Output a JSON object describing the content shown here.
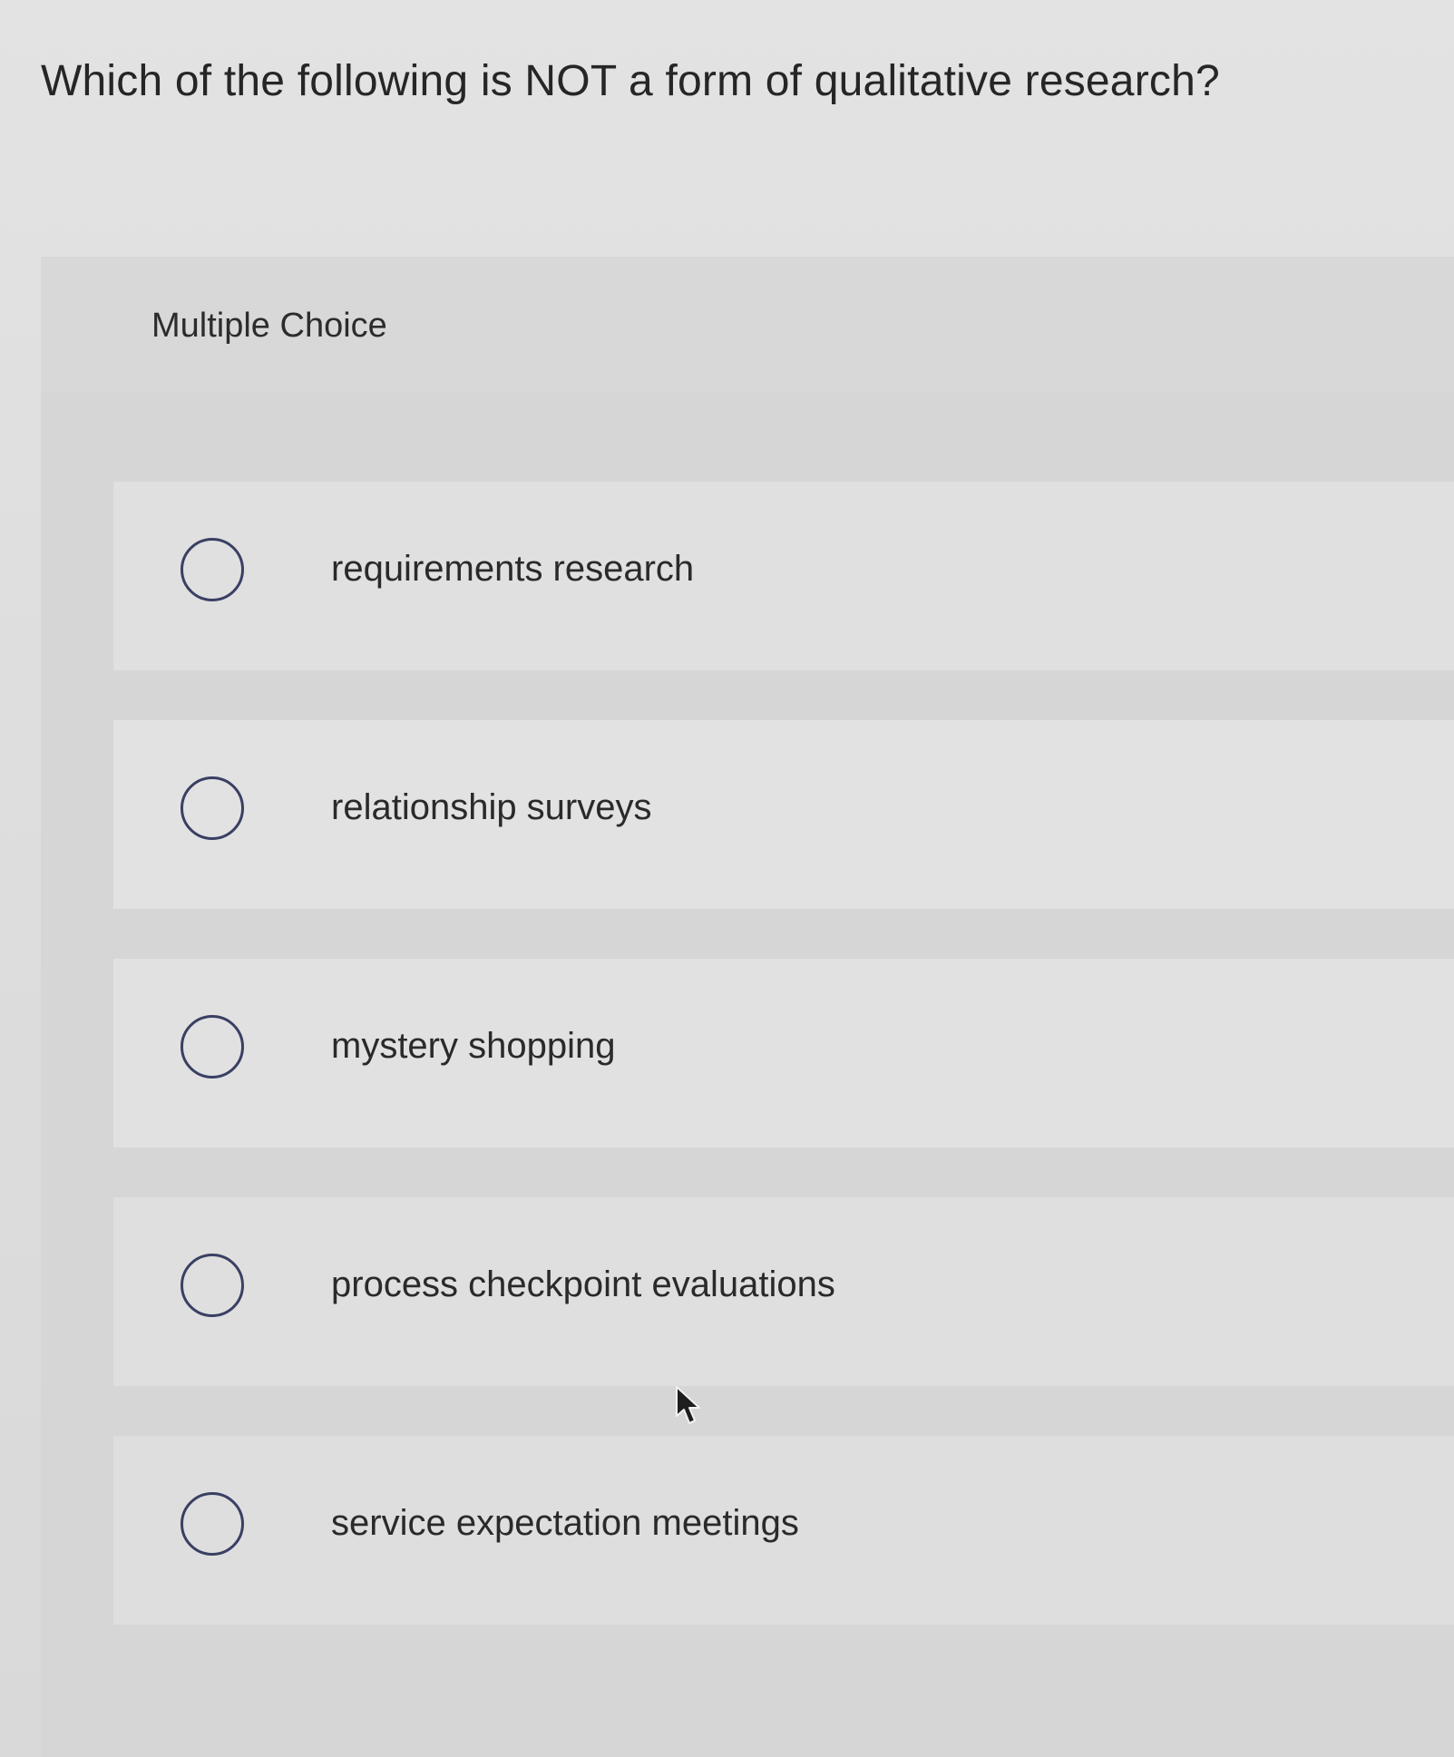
{
  "question": {
    "text": "Which of the following is NOT a form of qualitative research?"
  },
  "card": {
    "header_label": "Multiple Choice"
  },
  "options": [
    {
      "label": "requirements research",
      "selected": false
    },
    {
      "label": "relationship surveys",
      "selected": false
    },
    {
      "label": "mystery shopping",
      "selected": false
    },
    {
      "label": "process checkpoint evaluations",
      "selected": false
    },
    {
      "label": "service expectation meetings",
      "selected": false
    }
  ],
  "icons": {
    "radio": "radio-unselected-icon",
    "cursor": "mouse-pointer-icon"
  },
  "colors": {
    "radio_border": "#3a3f63",
    "text": "#2a2a2a"
  }
}
